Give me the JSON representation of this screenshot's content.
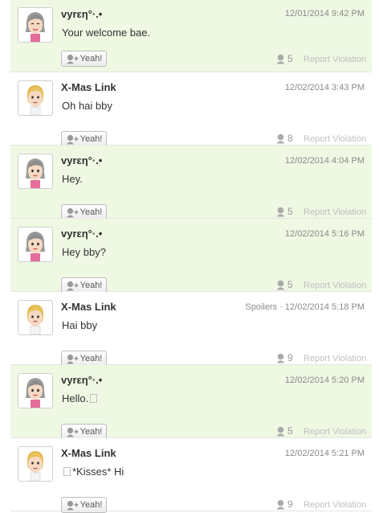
{
  "posts": [
    {
      "user": "vyrεη°·.•",
      "avatar": "gray-haired-mii-avatar",
      "time": "12/01/2014 9:42 PM",
      "tag": "",
      "message": "Your welcome bae.",
      "yeah_label": "Yeah!",
      "empathy": "5",
      "report": "Report Violation",
      "highlight": true
    },
    {
      "user": "X-Mas Link",
      "avatar": "blond-mii-avatar",
      "time": "12/02/2014 3:43 PM",
      "tag": "",
      "message": "Oh hai bby",
      "yeah_label": "Yeah!",
      "empathy": "8",
      "report": "Report Violation",
      "highlight": false
    },
    {
      "user": "vyrεη°·.•",
      "avatar": "gray-haired-mii-avatar",
      "time": "12/02/2014 4:04 PM",
      "tag": "",
      "message": "Hey.",
      "yeah_label": "Yeah!",
      "empathy": "5",
      "report": "Report Violation",
      "highlight": true
    },
    {
      "user": "vyrεη°·.•",
      "avatar": "gray-haired-mii-avatar",
      "time": "12/02/2014 5:16 PM",
      "tag": "",
      "message": "Hey bby?",
      "yeah_label": "Yeah!",
      "empathy": "5",
      "report": "Report Violation",
      "highlight": true
    },
    {
      "user": "X-Mas Link",
      "avatar": "blond-mii-avatar",
      "time": "12/02/2014 5:18 PM",
      "tag": "Spoilers · ",
      "message": "Hai bby",
      "yeah_label": "Yeah!",
      "empathy": "9",
      "report": "Report Violation",
      "highlight": false
    },
    {
      "user": "vyrεη°·.•",
      "avatar": "gray-haired-mii-avatar",
      "time": "12/02/2014 5:20 PM",
      "tag": "",
      "message": "Hello.",
      "message_suffix_box": true,
      "yeah_label": "Yeah!",
      "empathy": "5",
      "report": "Report Violation",
      "highlight": true
    },
    {
      "user": "X-Mas Link",
      "avatar": "blond-mii-avatar",
      "time": "12/02/2014 5:21 PM",
      "tag": "",
      "message": "*Kisses* Hi",
      "message_prefix_box": true,
      "yeah_label": "Yeah!",
      "empathy": "9",
      "report": "Report Violation",
      "highlight": false
    }
  ],
  "colors": {
    "highlight_bg": "#eef8e3",
    "text": "#333333",
    "meta": "#8a8a8a",
    "report": "#c0c0c0"
  }
}
